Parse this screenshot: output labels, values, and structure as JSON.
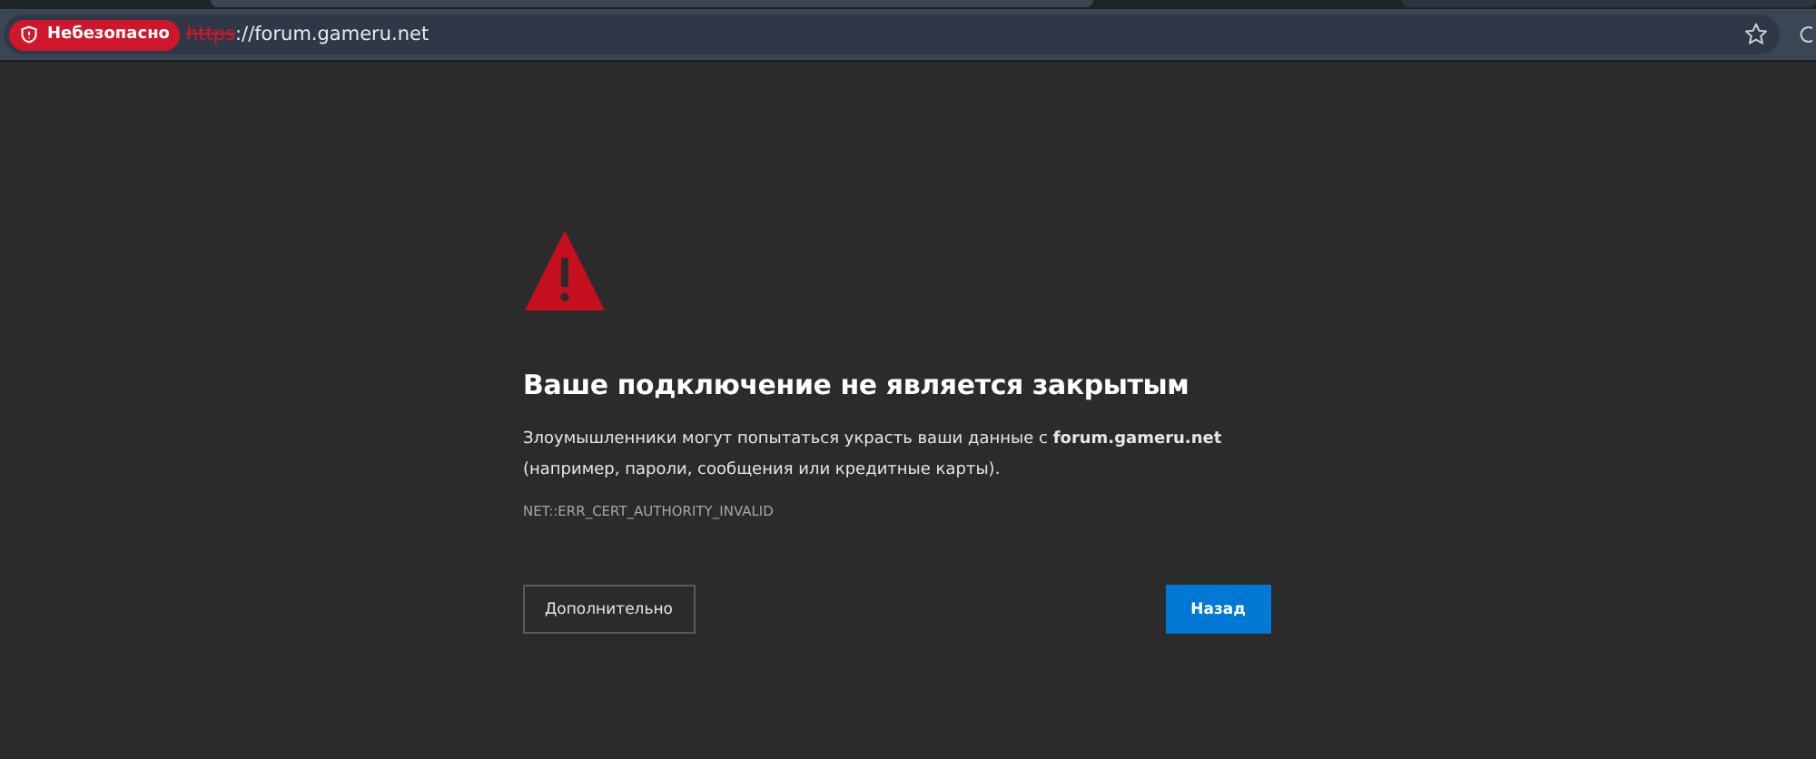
{
  "address_bar": {
    "security_label": "Небезопасно",
    "scheme": "https",
    "url_rest": "://forum.gameru.net"
  },
  "page": {
    "heading": "Ваше подключение не является закрытым",
    "paragraph": "Злоумышленники могут попытаться украсть ваши данные с **forum.gameru.net** (например, пароли, сообщения или кредитные карты).",
    "error_code": "NET::ERR_CERT_AUTHORITY_INVALID",
    "buttons": [
      {
        "label": "Дополнительно",
        "kind": "secondary"
      },
      {
        "label": "Назад",
        "kind": "primary"
      }
    ]
  }
}
